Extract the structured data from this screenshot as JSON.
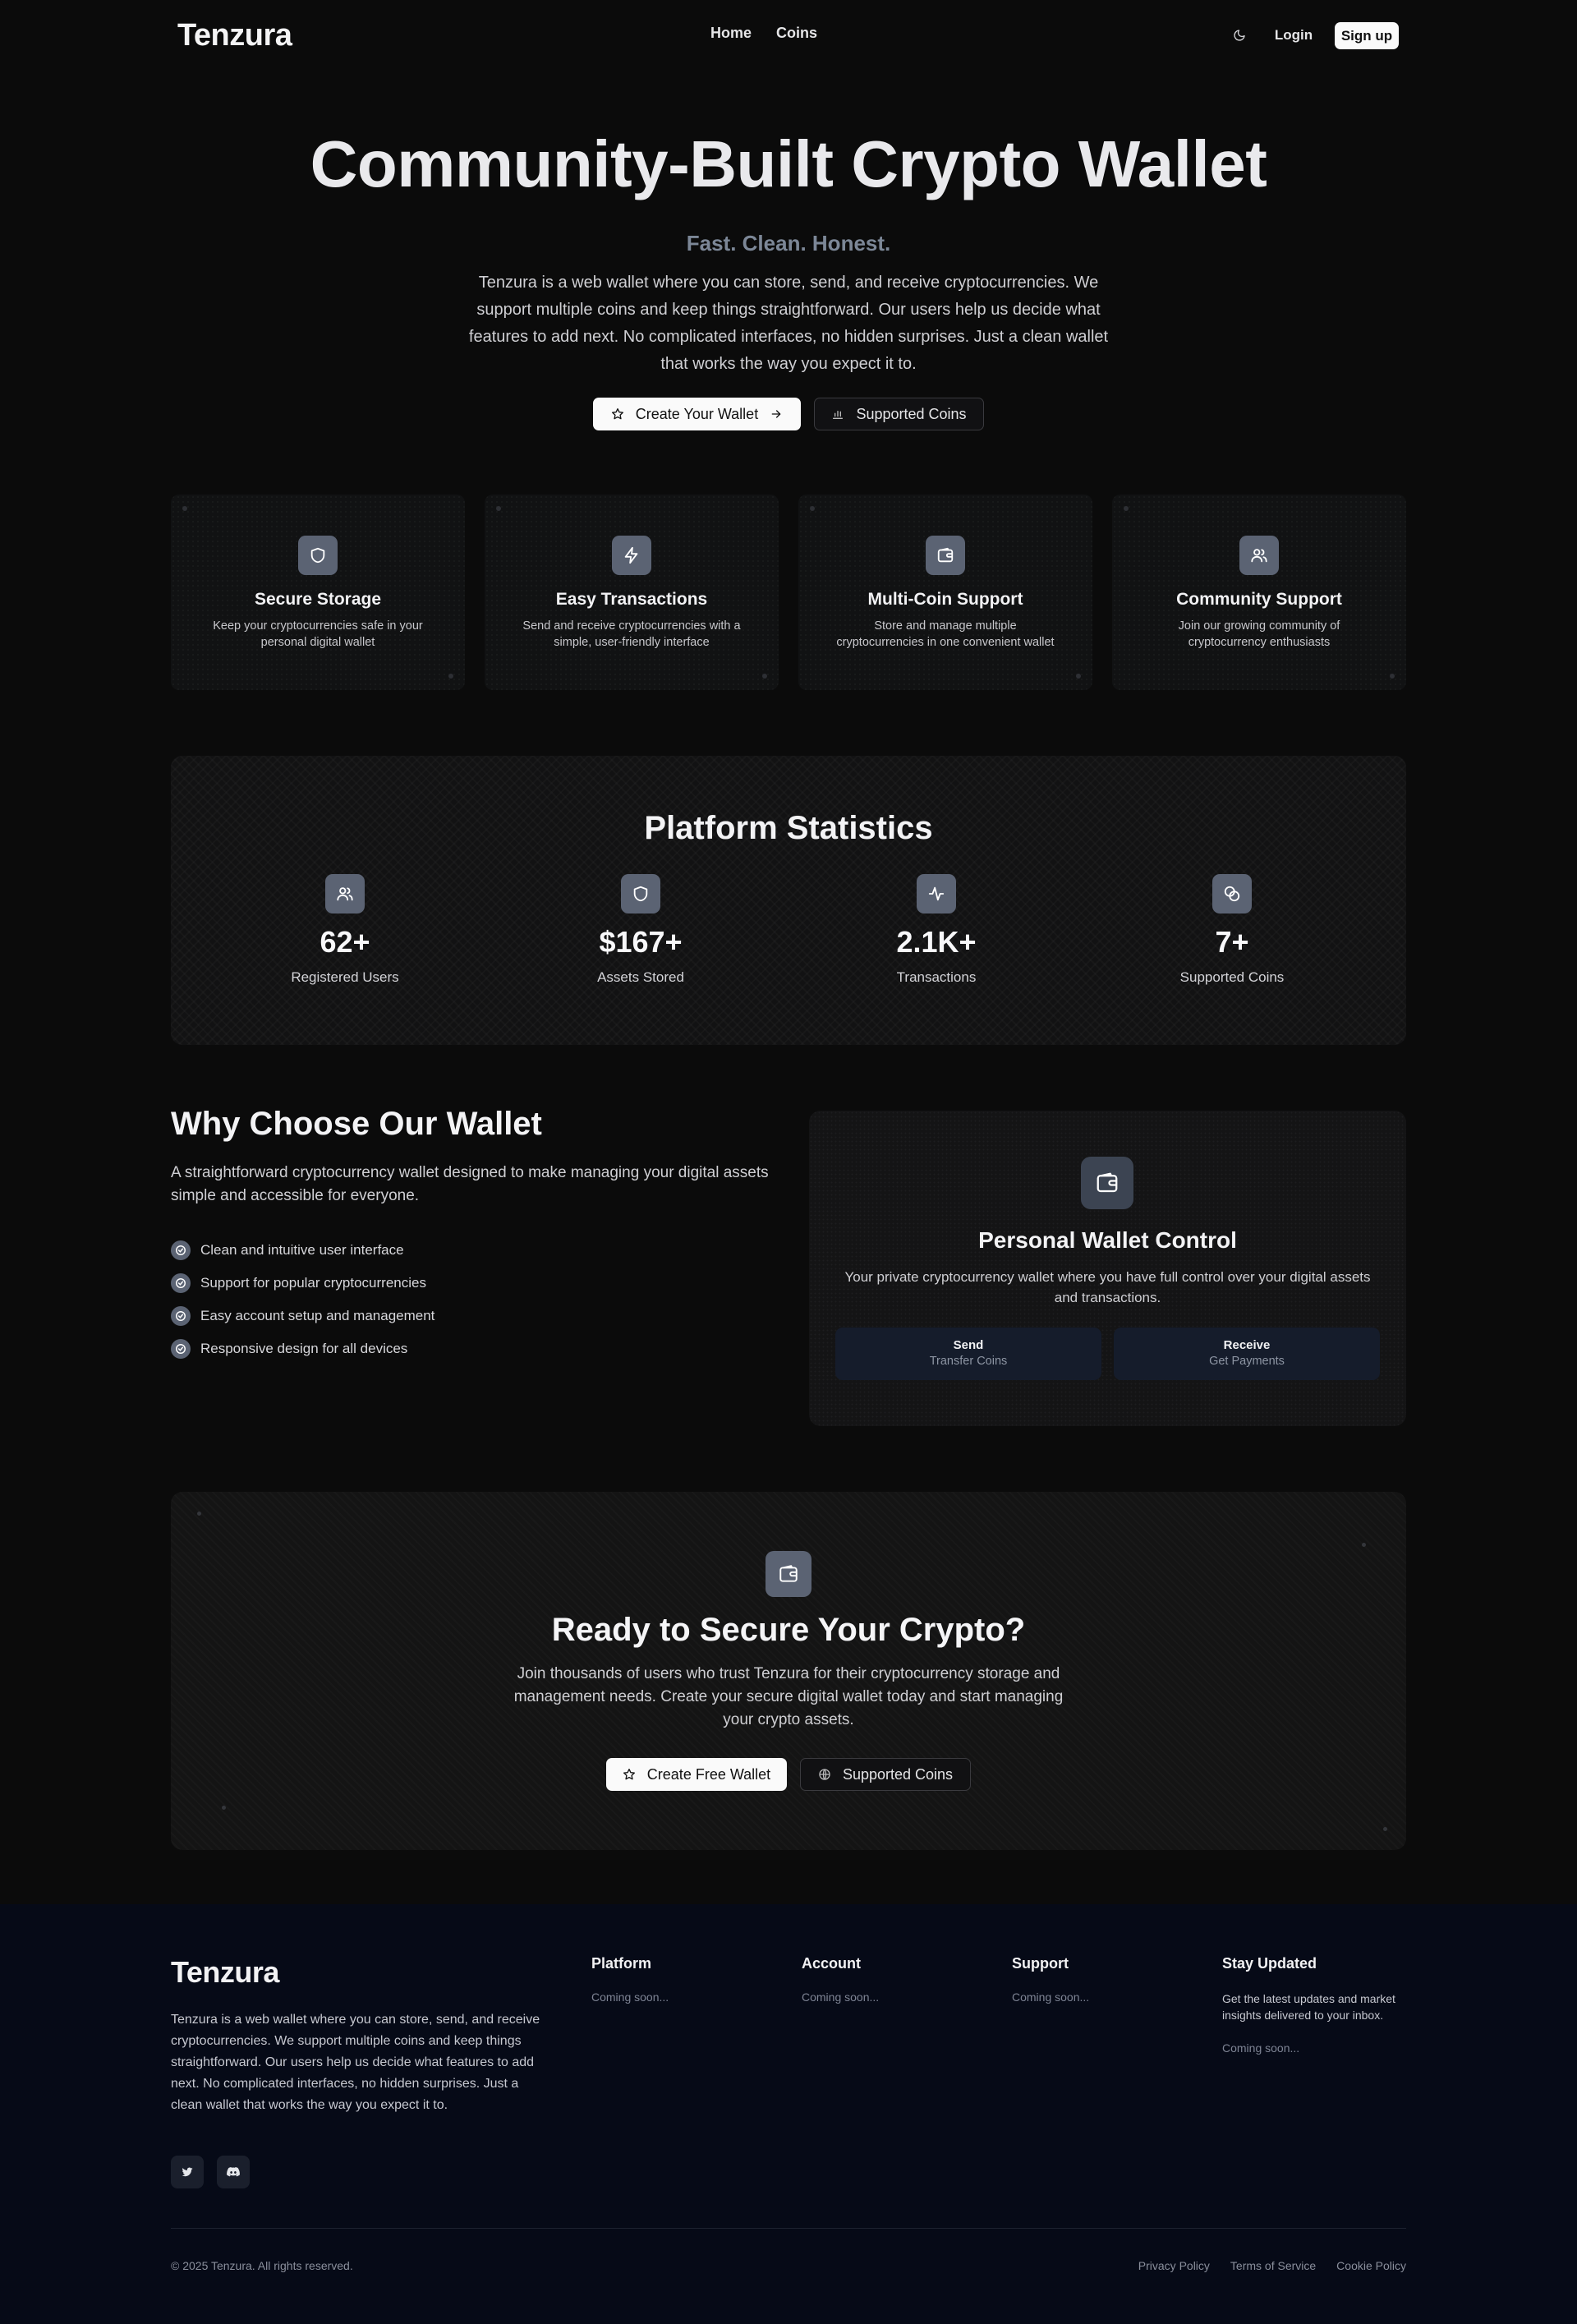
{
  "nav": {
    "logo": "Tenzura",
    "links": [
      "Home",
      "Coins"
    ],
    "login": "Login",
    "signup": "Sign up"
  },
  "hero": {
    "title": "Community-Built Crypto Wallet",
    "subtitle": "Fast. Clean. Honest.",
    "description": "Tenzura is a web wallet where you can store, send, and receive cryptocurrencies. We support multiple coins and keep things straightforward. Our users help us decide what features to add next. No complicated interfaces, no hidden surprises. Just a clean wallet that works the way you expect it to.",
    "primary_button": "Create Your Wallet",
    "secondary_button": "Supported Coins"
  },
  "features": [
    {
      "icon": "shield-icon",
      "title": "Secure Storage",
      "description": "Keep your cryptocurrencies safe in your personal digital wallet"
    },
    {
      "icon": "lightning-icon",
      "title": "Easy Transactions",
      "description": "Send and receive cryptocurrencies with a simple, user-friendly interface"
    },
    {
      "icon": "wallet-icon",
      "title": "Multi-Coin Support",
      "description": "Store and manage multiple cryptocurrencies in one convenient wallet"
    },
    {
      "icon": "users-icon",
      "title": "Community Support",
      "description": "Join our growing community of cryptocurrency enthusiasts"
    }
  ],
  "stats": {
    "title": "Platform Statistics",
    "items": [
      {
        "icon": "users-icon",
        "value": "62+",
        "label": "Registered Users"
      },
      {
        "icon": "shield-icon",
        "value": "$167+",
        "label": "Assets Stored"
      },
      {
        "icon": "activity-icon",
        "value": "2.1K+",
        "label": "Transactions"
      },
      {
        "icon": "coins-icon",
        "value": "7+",
        "label": "Supported Coins"
      }
    ]
  },
  "why": {
    "title": "Why Choose Our Wallet",
    "description": "A straightforward cryptocurrency wallet designed to make managing your digital assets simple and accessible for everyone.",
    "items": [
      "Clean and intuitive user interface",
      "Support for popular cryptocurrencies",
      "Easy account setup and management",
      "Responsive design for all devices"
    ],
    "card": {
      "title": "Personal Wallet Control",
      "description": "Your private cryptocurrency wallet where you have full control over your digital assets and transactions.",
      "send_title": "Send",
      "send_sub": "Transfer Coins",
      "receive_title": "Receive",
      "receive_sub": "Get Payments"
    }
  },
  "cta": {
    "title": "Ready to Secure Your Crypto?",
    "description": "Join thousands of users who trust Tenzura for their cryptocurrency storage and management needs. Create your secure digital wallet today and start managing your crypto assets.",
    "primary_button": "Create Free Wallet",
    "secondary_button": "Supported Coins"
  },
  "footer": {
    "logo": "Tenzura",
    "description": "Tenzura is a web wallet where you can store, send, and receive cryptocurrencies. We support multiple coins and keep things straightforward. Our users help us decide what features to add next. No complicated interfaces, no hidden surprises. Just a clean wallet that works the way you expect it to.",
    "columns": [
      {
        "title": "Platform",
        "text": "Coming soon..."
      },
      {
        "title": "Account",
        "text": "Coming soon..."
      },
      {
        "title": "Support",
        "text": "Coming soon..."
      }
    ],
    "updated": {
      "title": "Stay Updated",
      "text": "Get the latest updates and market insights delivered to your inbox.",
      "soon": "Coming soon..."
    },
    "copyright": "© 2025 Tenzura. All rights reserved.",
    "legal_links": [
      "Privacy Policy",
      "Terms of Service",
      "Cookie Policy"
    ]
  },
  "colors": {
    "background": "#0b0b0b",
    "icon_tile": "#5b6373",
    "footer_bg": "#060a17",
    "accent_text": "#7c8797"
  }
}
